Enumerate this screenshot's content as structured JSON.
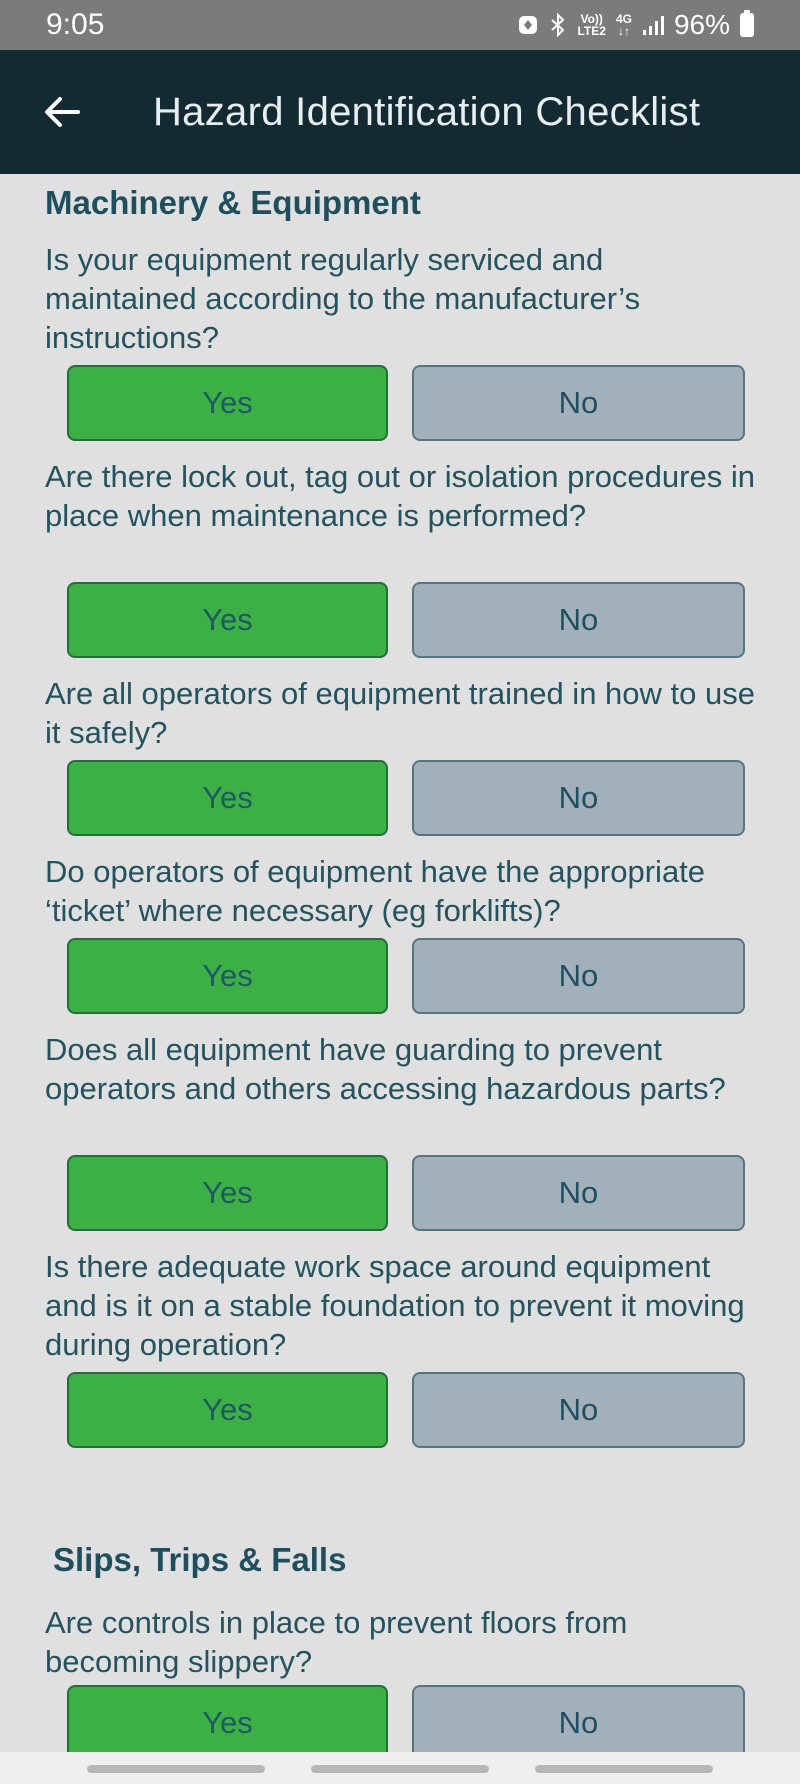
{
  "status": {
    "time": "9:05",
    "network_top": "Vo))",
    "network_bottom": "LTE2",
    "gen_top": "4G",
    "gen_bottom": "↓↑",
    "battery": "96%"
  },
  "header": {
    "title": "Hazard Identification Checklist"
  },
  "sections": [
    {
      "title": "Machinery & Equipment",
      "questions": [
        {
          "text": "Is your equipment regularly serviced and maintained according to the manufacturer’s instructions?",
          "yes": "Yes",
          "no": "No"
        },
        {
          "text": "Are there lock out, tag out or isolation procedures in place when maintenance is performed?",
          "yes": "Yes",
          "no": "No"
        },
        {
          "text": "Are all operators of equipment trained in how to use it safely?",
          "yes": "Yes",
          "no": "No"
        },
        {
          "text": "Do operators of equipment have the appropriate ‘ticket’ where necessary (eg forklifts)?",
          "yes": "Yes",
          "no": "No"
        },
        {
          "text": "Does all equipment have guarding to prevent operators and others accessing hazardous parts?",
          "yes": "Yes",
          "no": "No"
        },
        {
          "text": "Is there adequate work space around equipment and is it on a stable foundation to prevent it moving during operation?",
          "yes": "Yes",
          "no": "No"
        }
      ]
    },
    {
      "title": "Slips, Trips & Falls",
      "questions": [
        {
          "text": "Are controls in place to prevent floors from becoming slippery?",
          "yes": "Yes",
          "no": "No"
        }
      ]
    }
  ],
  "colors": {
    "header_bg": "#132a33",
    "yes_bg": "#3cb044",
    "no_bg": "#a3b0b9",
    "text": "#24535f"
  }
}
